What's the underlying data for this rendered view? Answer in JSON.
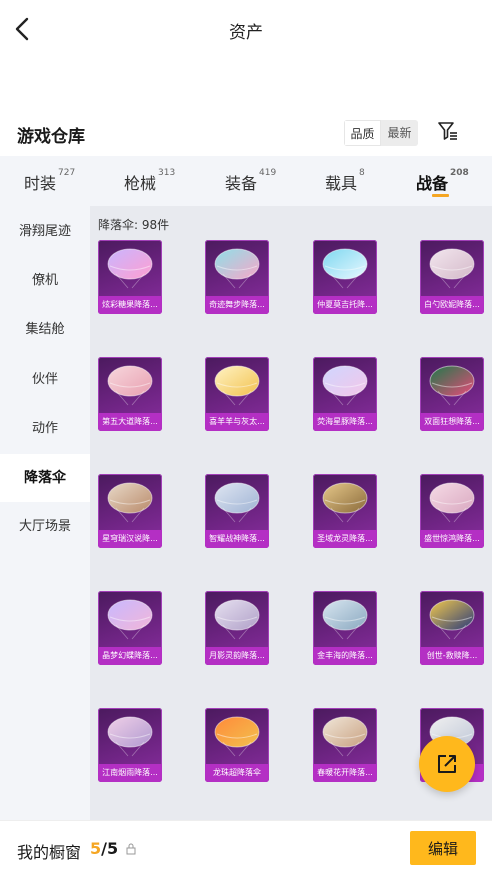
{
  "header": {
    "title": "资产",
    "back_icon": "chevron-left-icon"
  },
  "section": {
    "title": "游戏仓库",
    "sort_options": [
      "品质",
      "最新"
    ],
    "filter_icon": "filter-icon"
  },
  "categories": [
    {
      "label": "时装",
      "count": "727",
      "active": false
    },
    {
      "label": "枪械",
      "count": "313",
      "active": false
    },
    {
      "label": "装备",
      "count": "419",
      "active": false
    },
    {
      "label": "载具",
      "count": "8",
      "active": false
    },
    {
      "label": "战备",
      "count": "208",
      "active": true
    }
  ],
  "colors": {
    "accent": "#f5a623",
    "button": "#ffb81c",
    "card_bg": "#6e2483",
    "card_caption": "#b42fc4",
    "sidebar_bg": "#f3f5f9",
    "grid_bg": "#e8eaef"
  },
  "sidebar": {
    "items": [
      {
        "label": "滑翔尾迹",
        "active": false
      },
      {
        "label": "僚机",
        "active": false
      },
      {
        "label": "集结舱",
        "active": false
      },
      {
        "label": "伙伴",
        "active": false
      },
      {
        "label": "动作",
        "active": false
      },
      {
        "label": "降落伞",
        "active": true
      },
      {
        "label": "大厅场景",
        "active": false
      }
    ]
  },
  "grid": {
    "count_label": "降落伞: 98件",
    "items": [
      {
        "caption": "炫彩糖果降落...",
        "icon": "parachute-icon"
      },
      {
        "caption": "奇迹舞步降落...",
        "icon": "parachute-icon"
      },
      {
        "caption": "仲夏莫吉托降...",
        "icon": "parachute-icon"
      },
      {
        "caption": "白勺欧妮降落...",
        "icon": "parachute-icon"
      },
      {
        "caption": "第五大道降落...",
        "icon": "parachute-icon"
      },
      {
        "caption": "喜羊羊与灰太...",
        "icon": "parachute-icon"
      },
      {
        "caption": "荧海星豚降落...",
        "icon": "parachute-icon"
      },
      {
        "caption": "双面狂想降落...",
        "icon": "parachute-icon"
      },
      {
        "caption": "星穹瑞汉说降...",
        "icon": "parachute-icon"
      },
      {
        "caption": "智耀战神降落...",
        "icon": "parachute-icon"
      },
      {
        "caption": "圣域龙灵降落...",
        "icon": "parachute-icon"
      },
      {
        "caption": "盛世惊鸿降落...",
        "icon": "parachute-icon"
      },
      {
        "caption": "晶梦幻蝶降落...",
        "icon": "parachute-icon"
      },
      {
        "caption": "月影灵韵降落...",
        "icon": "parachute-icon"
      },
      {
        "caption": "金丰海的降落...",
        "icon": "parachute-icon"
      },
      {
        "caption": "创世-救赎降...",
        "icon": "parachute-icon"
      },
      {
        "caption": "江南烟雨降落...",
        "icon": "parachute-icon"
      },
      {
        "caption": "龙珠超降落伞",
        "icon": "parachute-icon"
      },
      {
        "caption": "春暖花开降落...",
        "icon": "parachute-icon"
      },
      {
        "caption": "",
        "icon": "parachute-icon"
      }
    ]
  },
  "share_button": {
    "icon": "external-link-icon"
  },
  "bottom_bar": {
    "label": "我的橱窗",
    "current": "5",
    "total": "/5",
    "lock_icon": "lock-icon",
    "edit_label": "编辑"
  }
}
